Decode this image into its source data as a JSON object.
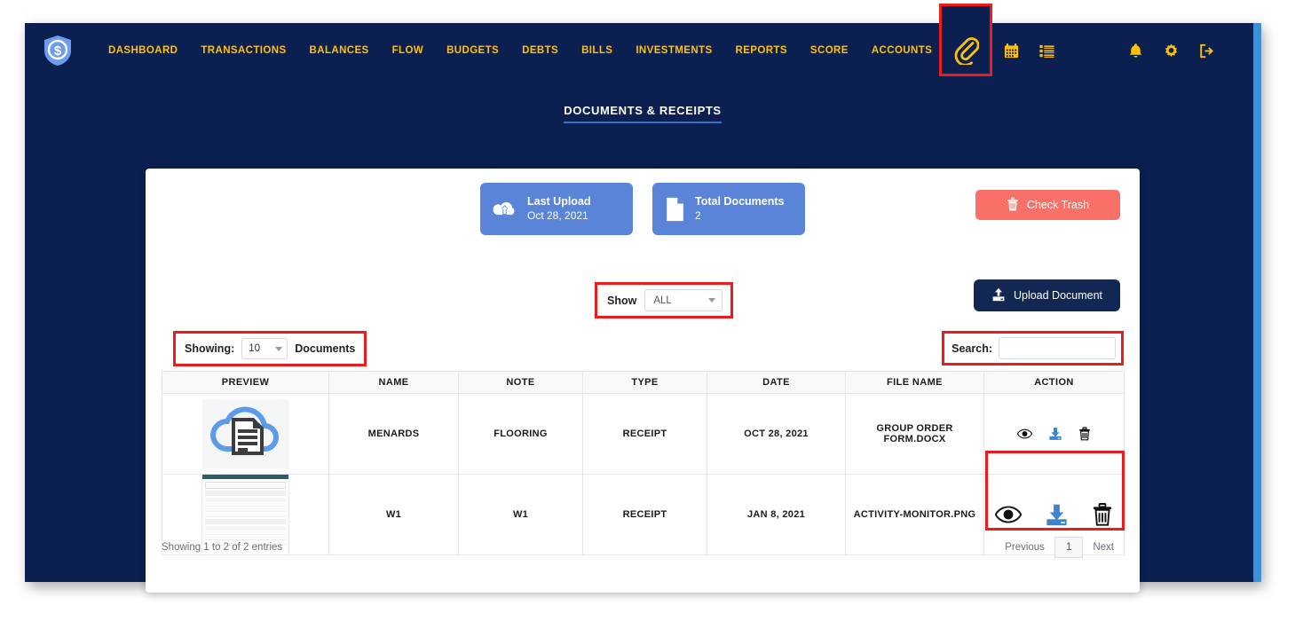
{
  "nav": {
    "brand_icon": "shield-dollar-logo",
    "links": [
      "DASHBOARD",
      "TRANSACTIONS",
      "BALANCES",
      "FLOW",
      "BUDGETS",
      "DEBTS",
      "BILLS",
      "INVESTMENTS",
      "REPORTS",
      "SCORE",
      "ACCOUNTS"
    ],
    "icons": [
      {
        "name": "refresh-icon",
        "glyph": "refresh"
      },
      {
        "name": "calendar-icon",
        "glyph": "calendar"
      },
      {
        "name": "list-icon",
        "glyph": "list"
      },
      {
        "name": "paperclip-icon",
        "glyph": "paperclip",
        "highlighted": true
      },
      {
        "name": "bell-icon",
        "glyph": "bell"
      },
      {
        "name": "gear-icon",
        "glyph": "gear"
      },
      {
        "name": "logout-icon",
        "glyph": "logout"
      }
    ]
  },
  "page": {
    "title": "DOCUMENTS & RECEIPTS"
  },
  "stats": [
    {
      "icon": "cloud-upload-icon",
      "label": "Last Upload",
      "value": "Oct 28, 2021"
    },
    {
      "icon": "document-icon",
      "label": "Total Documents",
      "value": "2"
    }
  ],
  "buttons": {
    "check_trash": "Check Trash",
    "upload_document": "Upload Document"
  },
  "filters": {
    "show_label": "Show",
    "show_value": "ALL",
    "showing_label": "Showing:",
    "showing_value": "10",
    "showing_suffix": "Documents",
    "search_label": "Search:",
    "search_value": "",
    "search_placeholder": ""
  },
  "table": {
    "columns": [
      "PREVIEW",
      "NAME",
      "NOTE",
      "TYPE",
      "DATE",
      "FILE NAME",
      "ACTION"
    ],
    "rows": [
      {
        "preview": "cloud-document-thumbnail",
        "name": "MENARDS",
        "note": "FLOORING",
        "type": "RECEIPT",
        "date": "OCT 28, 2021",
        "file_name": "GROUP ORDER FORM.DOCX",
        "actions": [
          "view-icon",
          "download-icon",
          "delete-icon"
        ]
      },
      {
        "preview": "activity-monitor-thumbnail",
        "name": "W1",
        "note": "W1",
        "type": "RECEIPT",
        "date": "JAN 8, 2021",
        "file_name": "ACTIVITY-MONITOR.PNG",
        "actions": [
          "view-icon",
          "download-icon",
          "delete-icon"
        ]
      }
    ]
  },
  "footer": {
    "entries": "Showing 1 to 2 of 2 entries",
    "previous": "Previous",
    "page": "1",
    "next": "Next"
  },
  "colors": {
    "app_background": "#0b2050",
    "nav_text": "#ffc107",
    "stat_card": "#5a84d8",
    "danger": "#f97068",
    "primary_dark": "#122753",
    "highlight_box": "#ef1a1a",
    "scrollbar": "#3f8fd6"
  }
}
